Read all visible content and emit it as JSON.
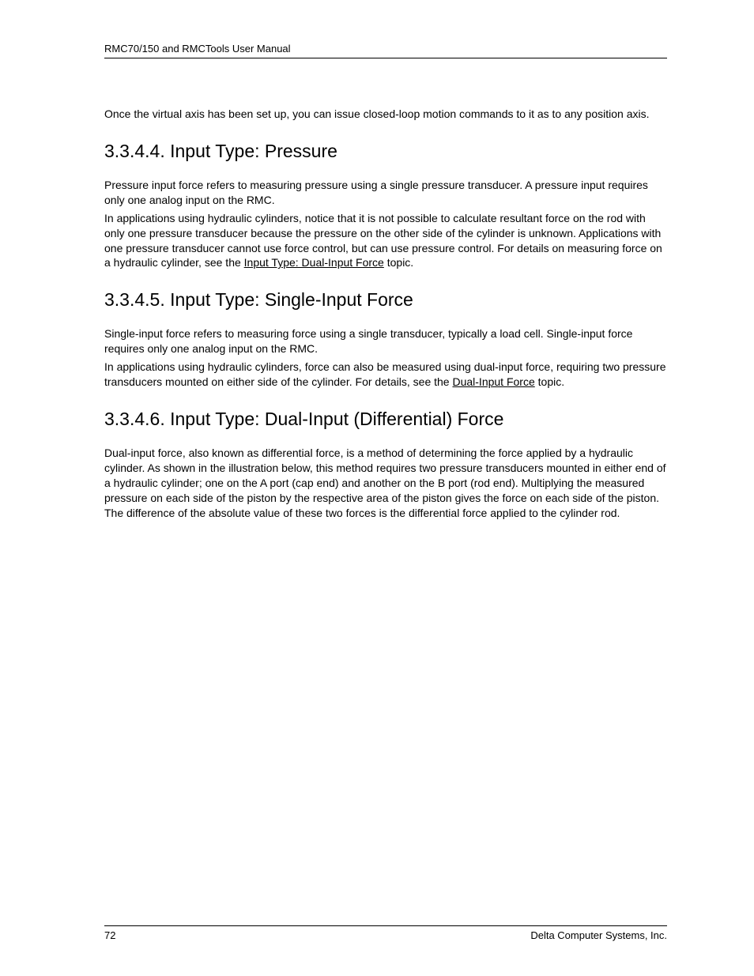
{
  "header": {
    "title": "RMC70/150 and RMCTools User Manual"
  },
  "intro": {
    "text": "Once the virtual axis has been set up, you can issue closed-loop motion commands to it as to any position axis."
  },
  "sections": {
    "s1": {
      "heading": "3.3.4.4. Input Type: Pressure",
      "p1": "Pressure input force refers to measuring pressure using a single pressure transducer. A pressure input requires only one analog input on the RMC.",
      "p2a": "In applications using hydraulic cylinders, notice that it is not possible to calculate resultant force on the rod with only one pressure transducer because the pressure on the other side of the cylinder is unknown.  Applications with one pressure transducer cannot use force control, but can use pressure control. For details on measuring force on a hydraulic cylinder, see the ",
      "p2_link": "Input Type: Dual-Input Force",
      "p2b": " topic."
    },
    "s2": {
      "heading": "3.3.4.5. Input Type: Single-Input Force",
      "p1": "Single-input force refers to measuring force using a single transducer, typically a load cell. Single-input force requires only one analog input on the RMC.",
      "p2a": "In applications using hydraulic cylinders, force can also be measured using dual-input force, requiring two pressure transducers mounted on either side of the cylinder. For details, see the ",
      "p2_link": "Dual-Input Force",
      "p2b": " topic."
    },
    "s3": {
      "heading": "3.3.4.6. Input Type: Dual-Input (Differential) Force",
      "p1": "Dual-input force, also known as differential force, is a method of determining the force applied by a hydraulic cylinder. As shown in the illustration below, this method requires two pressure transducers mounted in either end of a hydraulic cylinder; one on the A port (cap end) and another on the B port (rod end). Multiplying the measured pressure on each side of the piston by the respective area of the piston gives the force on each side of the piston. The difference of the absolute value of these two forces is the differential force applied to the cylinder rod."
    }
  },
  "footer": {
    "page": "72",
    "company": "Delta Computer Systems, Inc."
  }
}
